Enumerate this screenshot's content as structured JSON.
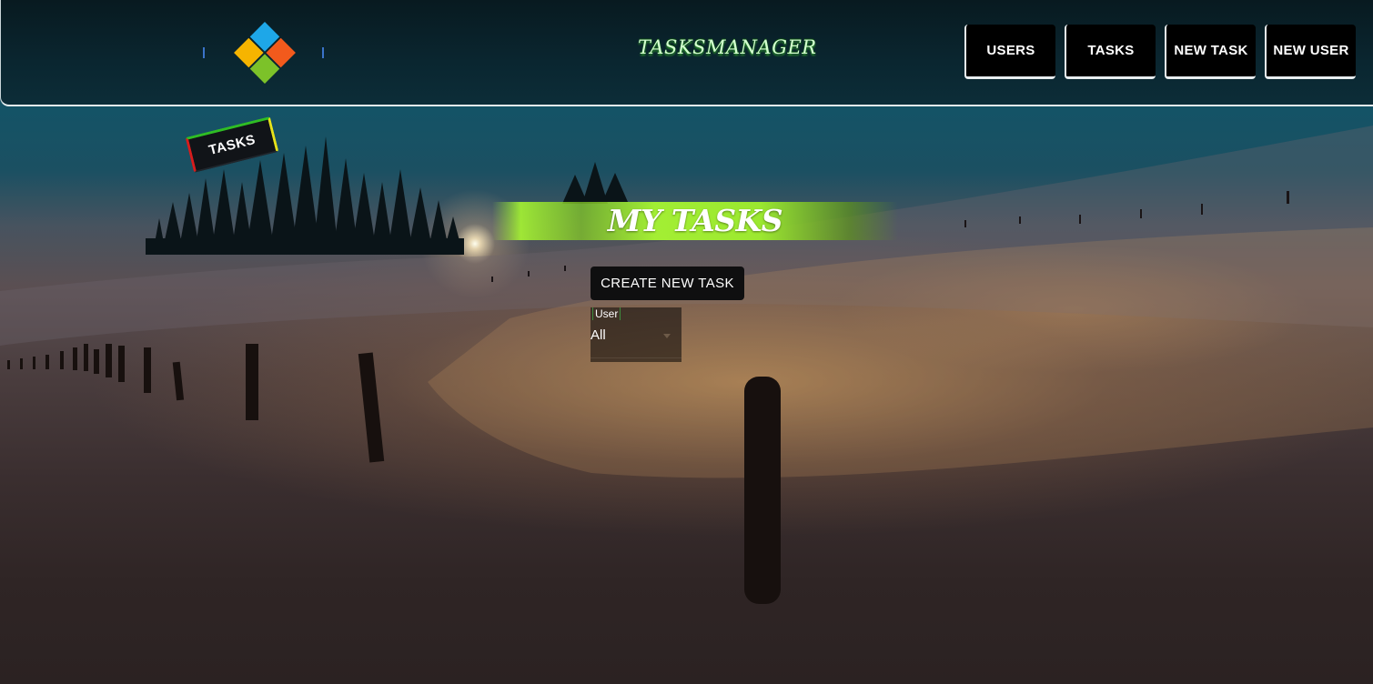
{
  "header": {
    "brand": "TASKSMANAGER",
    "nav": [
      {
        "label": "USERS"
      },
      {
        "label": "TASKS"
      },
      {
        "label": "NEW TASK"
      },
      {
        "label": "NEW USER"
      }
    ]
  },
  "tag": {
    "label": "TASKS"
  },
  "main": {
    "heading": "MY TASKS",
    "create_button": "CREATE NEW TASK",
    "user_filter": {
      "label": "User",
      "value": "All"
    }
  },
  "colors": {
    "accent_green": "#adff2f",
    "logo_blue": "#1ea7e8",
    "logo_orange": "#f25a1c",
    "logo_yellow": "#f6b400",
    "logo_green": "#7cc229"
  }
}
